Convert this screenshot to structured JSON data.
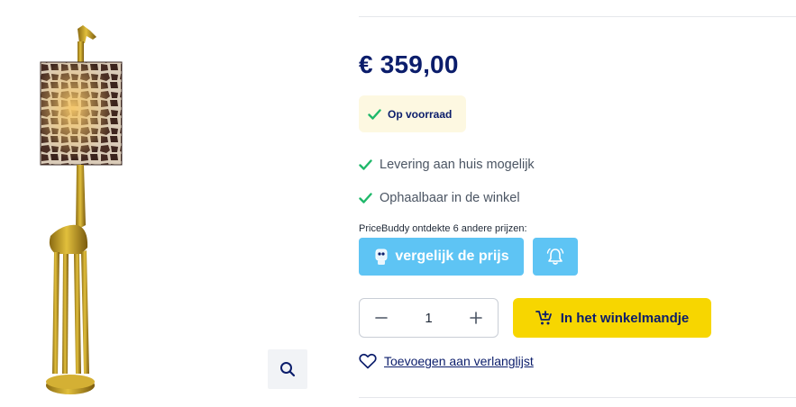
{
  "product": {
    "image_alt": "Giraffe floor lamp with giraffe-print shade"
  },
  "price": "€ 359,00",
  "stock": {
    "label": "Op voorraad",
    "color": "#1fb86a"
  },
  "features": [
    {
      "label": "Levering aan huis mogelijk",
      "icon": "check-icon"
    },
    {
      "label": "Ophaalbaar in de winkel",
      "icon": "check-icon"
    }
  ],
  "pricebuddy": {
    "text": "PriceBuddy ontdekte 6 andere prijzen:",
    "compare_label": "vergelijk de prijs",
    "compare_icon": "pricebuddy-mascot-icon",
    "alert_icon": "bell-icon",
    "color": "#5ec4f4"
  },
  "quantity": {
    "value": "1",
    "minus_icon": "minus-icon",
    "plus_icon": "plus-icon"
  },
  "cart": {
    "label": "In het winkelmandje",
    "icon": "cart-add-icon",
    "color": "#f7d600"
  },
  "wishlist": {
    "label": "Toevoegen aan verlanglijst",
    "icon": "heart-icon"
  },
  "zoom": {
    "icon": "search-icon"
  },
  "colors": {
    "brand_navy": "#0b1d6b",
    "divider": "#e5e7eb"
  }
}
